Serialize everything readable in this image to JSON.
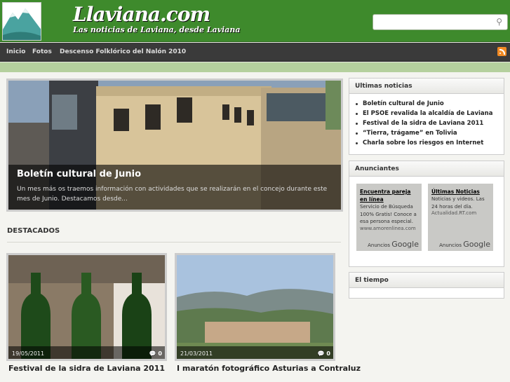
{
  "header": {
    "site_title": "Llaviana.com",
    "tagline": "Las noticias de Laviana, desde Laviana",
    "search_placeholder": "",
    "search_icon": "search-icon"
  },
  "nav": {
    "items": [
      "Inicio",
      "Fotos",
      "Descenso Folklórico del Nalón 2010"
    ],
    "rss_icon": "rss-icon"
  },
  "featured": {
    "title": "Boletín cultural de Junio",
    "excerpt": "Un mes más os traemos información con actividades que se realizarán en el concejo durante este mes de Junio. Destacamos desde..."
  },
  "destacados": {
    "heading": "DESTACADOS",
    "cards": [
      {
        "date": "19/05/2011",
        "comments": "0",
        "title": "Festival de la sidra de Laviana 2011"
      },
      {
        "date": "21/03/2011",
        "comments": "0",
        "title": "I maratón fotográfico Asturias a Contraluz"
      }
    ]
  },
  "sidebar": {
    "news_title": "Ultimas noticias",
    "news": [
      "Boletín cultural de Junio",
      "El PSOE revalida la alcaldía de Laviana",
      "Festival de la sidra de Laviana 2011",
      "“Tierra, trágame” en Tolivia",
      "Charla sobre los riesgos en Internet"
    ],
    "ads_title": "Anunciantes",
    "ads": [
      {
        "title": "Encuentra pareja en línea",
        "body": "Servicio de Búsqueda 100% Gratis! Conoce a esa persona especial.",
        "url": "www.amorenlinea.com",
        "footer": "Anuncios",
        "brand": "Google"
      },
      {
        "title": "Últimas Noticias",
        "body": "Noticias y videos. Las 24 horas del día.",
        "url": "Actualidad.RT.com",
        "footer": "Anuncios",
        "brand": "Google"
      }
    ],
    "weather_title": "El tiempo"
  },
  "colors": {
    "header_green": "#3e8a2c",
    "nav_dark": "#3a3a3a",
    "band_green": "#b5d09e"
  }
}
